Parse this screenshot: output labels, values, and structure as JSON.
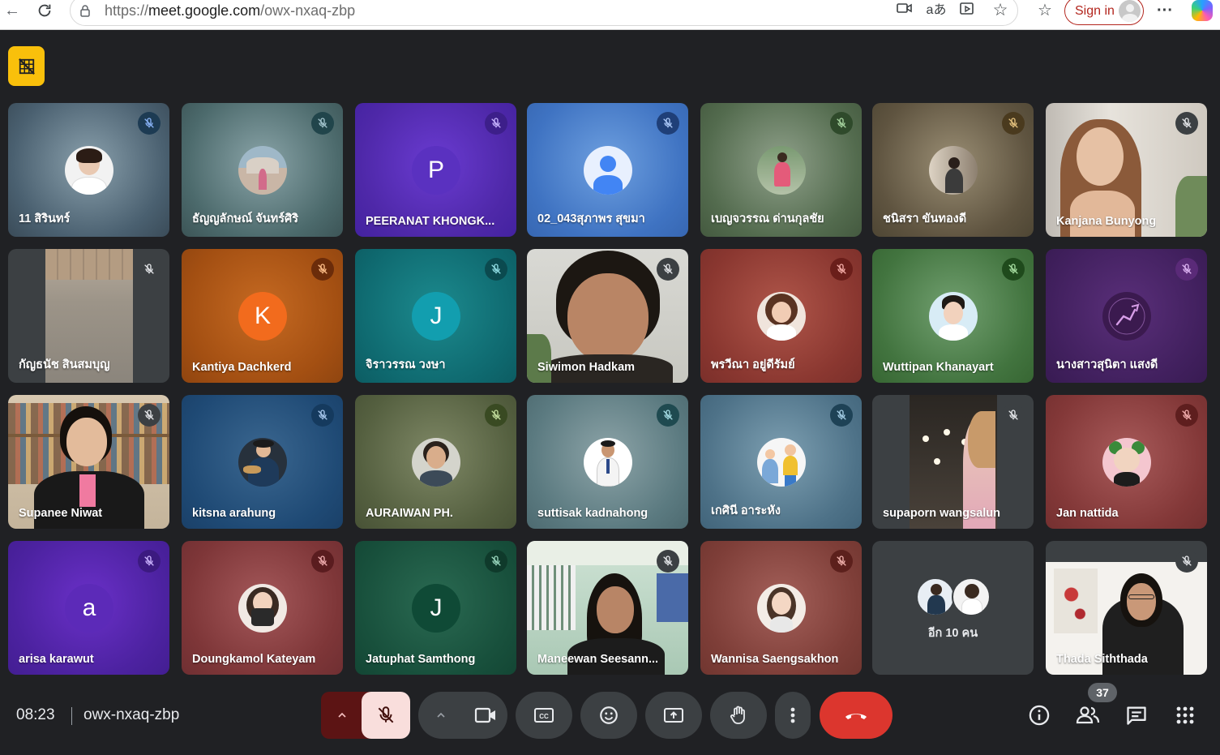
{
  "browser": {
    "url_prefix": "https://",
    "url_host": "meet.google.com",
    "url_path": "/owx-nxaq-zbp",
    "signin_label": "Sign in"
  },
  "participants": [
    {
      "name": "11 สิรินทร์"
    },
    {
      "name": "ธัญญลักษณ์ จันทร์ศิริ"
    },
    {
      "name": "PEERANAT KHONGK...",
      "initial": "P"
    },
    {
      "name": "02_043สุภาพร สุขมา"
    },
    {
      "name": "เบญจวรรณ ด่านกุลชัย"
    },
    {
      "name": "ชนิสรา ขันทองดี"
    },
    {
      "name": "Kanjana Bunyong"
    },
    {
      "name": "กัญธนัช สินสมบุญ"
    },
    {
      "name": "Kantiya Dachkerd",
      "initial": "K"
    },
    {
      "name": "จิราวรรณ วงษา",
      "initial": "J"
    },
    {
      "name": "Siwimon Hadkam"
    },
    {
      "name": "พรวีณา อยู่ดีรัมย์"
    },
    {
      "name": "Wuttipan Khanayart"
    },
    {
      "name": "นางสาวสุนิตา แสงดี"
    },
    {
      "name": "Supanee Niwat"
    },
    {
      "name": "kitsna arahung"
    },
    {
      "name": "AURAIWAN PH."
    },
    {
      "name": "suttisak kadnahong"
    },
    {
      "name": "เกศินี อาระหัง"
    },
    {
      "name": "supaporn wangsalun"
    },
    {
      "name": "Jan nattida"
    },
    {
      "name": "arisa karawut",
      "initial": "a"
    },
    {
      "name": "Doungkamol Kateyam"
    },
    {
      "name": "Jatuphat Samthong",
      "initial": "J"
    },
    {
      "name": "Maneewan Seesann..."
    },
    {
      "name": "Wannisa Saengsakhon"
    },
    {
      "name": "อีก 10 คน"
    },
    {
      "name": "Thada Siththada"
    }
  ],
  "footer": {
    "time": "08:23",
    "meeting_code": "owx-nxaq-zbp",
    "participant_count": "37"
  },
  "icons": [
    "lock-icon",
    "camera-icon",
    "translate-icon",
    "immersive-reader-icon",
    "star-icon",
    "favorites-icon",
    "more-icon",
    "copilot-icon",
    "mic-off-icon",
    "hand-icon",
    "emoji-icon",
    "captions-icon",
    "present-icon",
    "end-call-icon",
    "info-icon",
    "people-icon",
    "chat-icon",
    "activities-icon"
  ]
}
